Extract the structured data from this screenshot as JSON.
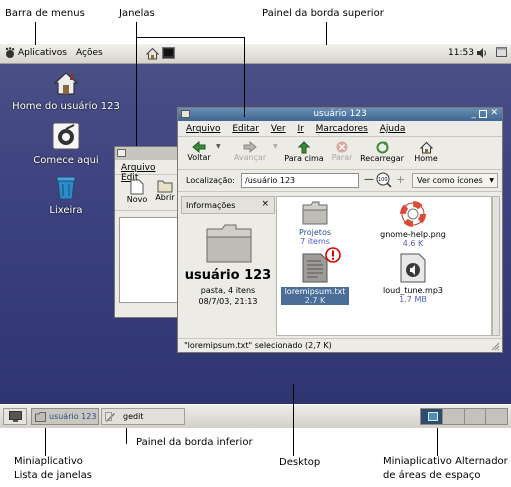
{
  "callouts": {
    "menu_bar": "Barra de menus",
    "windows": "Janelas",
    "top_panel": "Painel da borda superior",
    "bottom_panel": "Painel da borda inferior",
    "desktop": "Desktop",
    "window_list_line1": "Miniaplicativo",
    "window_list_line2": "Lista de janelas",
    "workspace_line1": "Miniaplicativo Alternador",
    "workspace_line2": "de áreas de espaço"
  },
  "top_panel": {
    "menus": [
      "Aplicativos",
      "Ações"
    ],
    "clock": "11:53"
  },
  "desktop_icons": [
    {
      "label": "Home do usuário 123",
      "icon": "home-icon"
    },
    {
      "label": "Comece aqui",
      "icon": "start-here-icon"
    },
    {
      "label": "Lixeira",
      "icon": "trash-icon"
    }
  ],
  "back_window": {
    "menus": [
      "Arquivo",
      "Edit"
    ],
    "buttons": [
      "Novo",
      "Abrir"
    ]
  },
  "file_window": {
    "title": "usuário 123",
    "menus": [
      "Arquivo",
      "Editar",
      "Ver",
      "Ir",
      "Marcadores",
      "Ajuda"
    ],
    "toolbar": {
      "back": "Voltar",
      "forward": "Avançar",
      "up": "Para cima",
      "stop": "Parar",
      "reload": "Recarregar",
      "home": "Home"
    },
    "location_label": "Localização:",
    "location_value": "/usuário 123",
    "zoom": "100",
    "view_as": "Ver como ícones",
    "side_pane": {
      "title": "Informações",
      "name": "usuário 123",
      "detail1": "pasta, 4 itens",
      "detail2": "08/7/03, 21:13"
    },
    "files": [
      {
        "name": "Projetos",
        "info": "7 items",
        "icon": "folder-icon"
      },
      {
        "name": "gnome-help.png",
        "info": "4.6 K",
        "icon": "lifebuoy-icon"
      },
      {
        "name": "loremipsum.txt",
        "info": "2.7 K",
        "icon": "text-file-icon"
      },
      {
        "name": "loud_tune.mp3",
        "info": "1.7 MB",
        "icon": "audio-file-icon"
      }
    ],
    "status": "\"loremipsum.txt\" selecionado (2,7 K)"
  },
  "taskbar": {
    "tasks": [
      "usuário 123",
      "gedit"
    ]
  },
  "colors": {
    "desktop": "#3d4280",
    "selection": "#4b6e99",
    "title_active": "#4f77a0"
  }
}
